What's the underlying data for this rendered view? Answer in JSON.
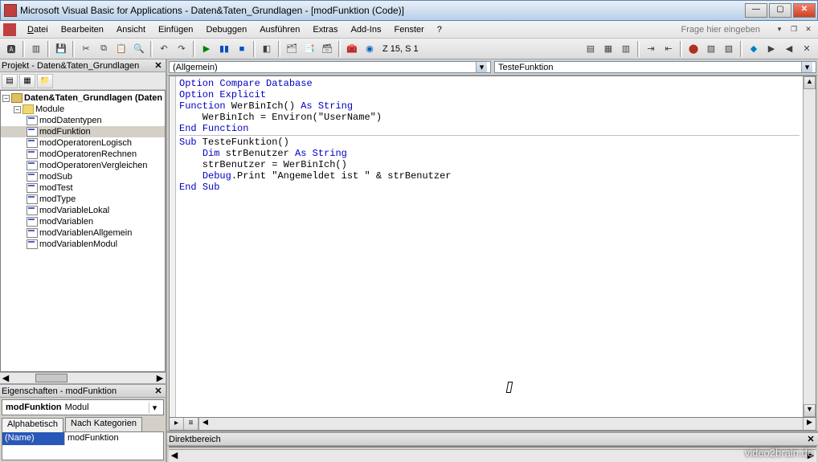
{
  "window": {
    "title": "Microsoft Visual Basic for Applications - Daten&Taten_Grundlagen - [modFunktion (Code)]",
    "help_placeholder": "Frage hier eingeben"
  },
  "menu": {
    "file": "Datei",
    "edit": "Bearbeiten",
    "view": "Ansicht",
    "insert": "Einfügen",
    "debug": "Debuggen",
    "run": "Ausführen",
    "extras": "Extras",
    "addins": "Add-Ins",
    "window": "Fenster",
    "help": "?"
  },
  "toolbar": {
    "position": "Z 15, S 1"
  },
  "project_pane": {
    "title": "Projekt - Daten&Taten_Grundlagen",
    "root": "Daten&Taten_Grundlagen (Daten",
    "folder": "Module",
    "modules": [
      "modDatentypen",
      "modFunktion",
      "modOperatorenLogisch",
      "modOperatorenRechnen",
      "modOperatorenVergleichen",
      "modSub",
      "modTest",
      "modType",
      "modVariableLokal",
      "modVariablen",
      "modVariablenAllgemein",
      "modVariablenModul"
    ],
    "selected": "modFunktion"
  },
  "properties_pane": {
    "title": "Eigenschaften - modFunktion",
    "object_name": "modFunktion",
    "object_type": "Modul",
    "tab_alpha": "Alphabetisch",
    "tab_cat": "Nach Kategorien",
    "prop_name_label": "(Name)",
    "prop_name_value": "modFunktion"
  },
  "code_dropdowns": {
    "left": "(Allgemein)",
    "right": "TesteFunktion"
  },
  "code": {
    "lines": [
      {
        "t": "Option Compare Database",
        "kw": [
          "Option",
          "Compare",
          "Database"
        ]
      },
      {
        "t": "Option Explicit",
        "kw": [
          "Option",
          "Explicit"
        ]
      },
      {
        "t": ""
      },
      {
        "t": "Function WerBinIch() As String",
        "kw": [
          "Function",
          "As",
          "String"
        ]
      },
      {
        "t": "    WerBinIch = Environ(\"UserName\")"
      },
      {
        "t": "End Function",
        "kw": [
          "End",
          "Function"
        ]
      },
      {
        "t": "",
        "hr": true
      },
      {
        "t": ""
      },
      {
        "t": "Sub TesteFunktion()",
        "kw": [
          "Sub"
        ]
      },
      {
        "t": "    Dim strBenutzer As String",
        "kw": [
          "Dim",
          "As",
          "String"
        ]
      },
      {
        "t": ""
      },
      {
        "t": "    strBenutzer = WerBinIch()"
      },
      {
        "t": "    Debug.Print \"Angemeldet ist \" & strBenutzer",
        "kw": [
          "Debug"
        ]
      },
      {
        "t": "End Sub",
        "kw": [
          "End",
          "Sub"
        ]
      }
    ]
  },
  "immediate": {
    "title": "Direktbereich"
  },
  "watermark": "video2brain.de"
}
